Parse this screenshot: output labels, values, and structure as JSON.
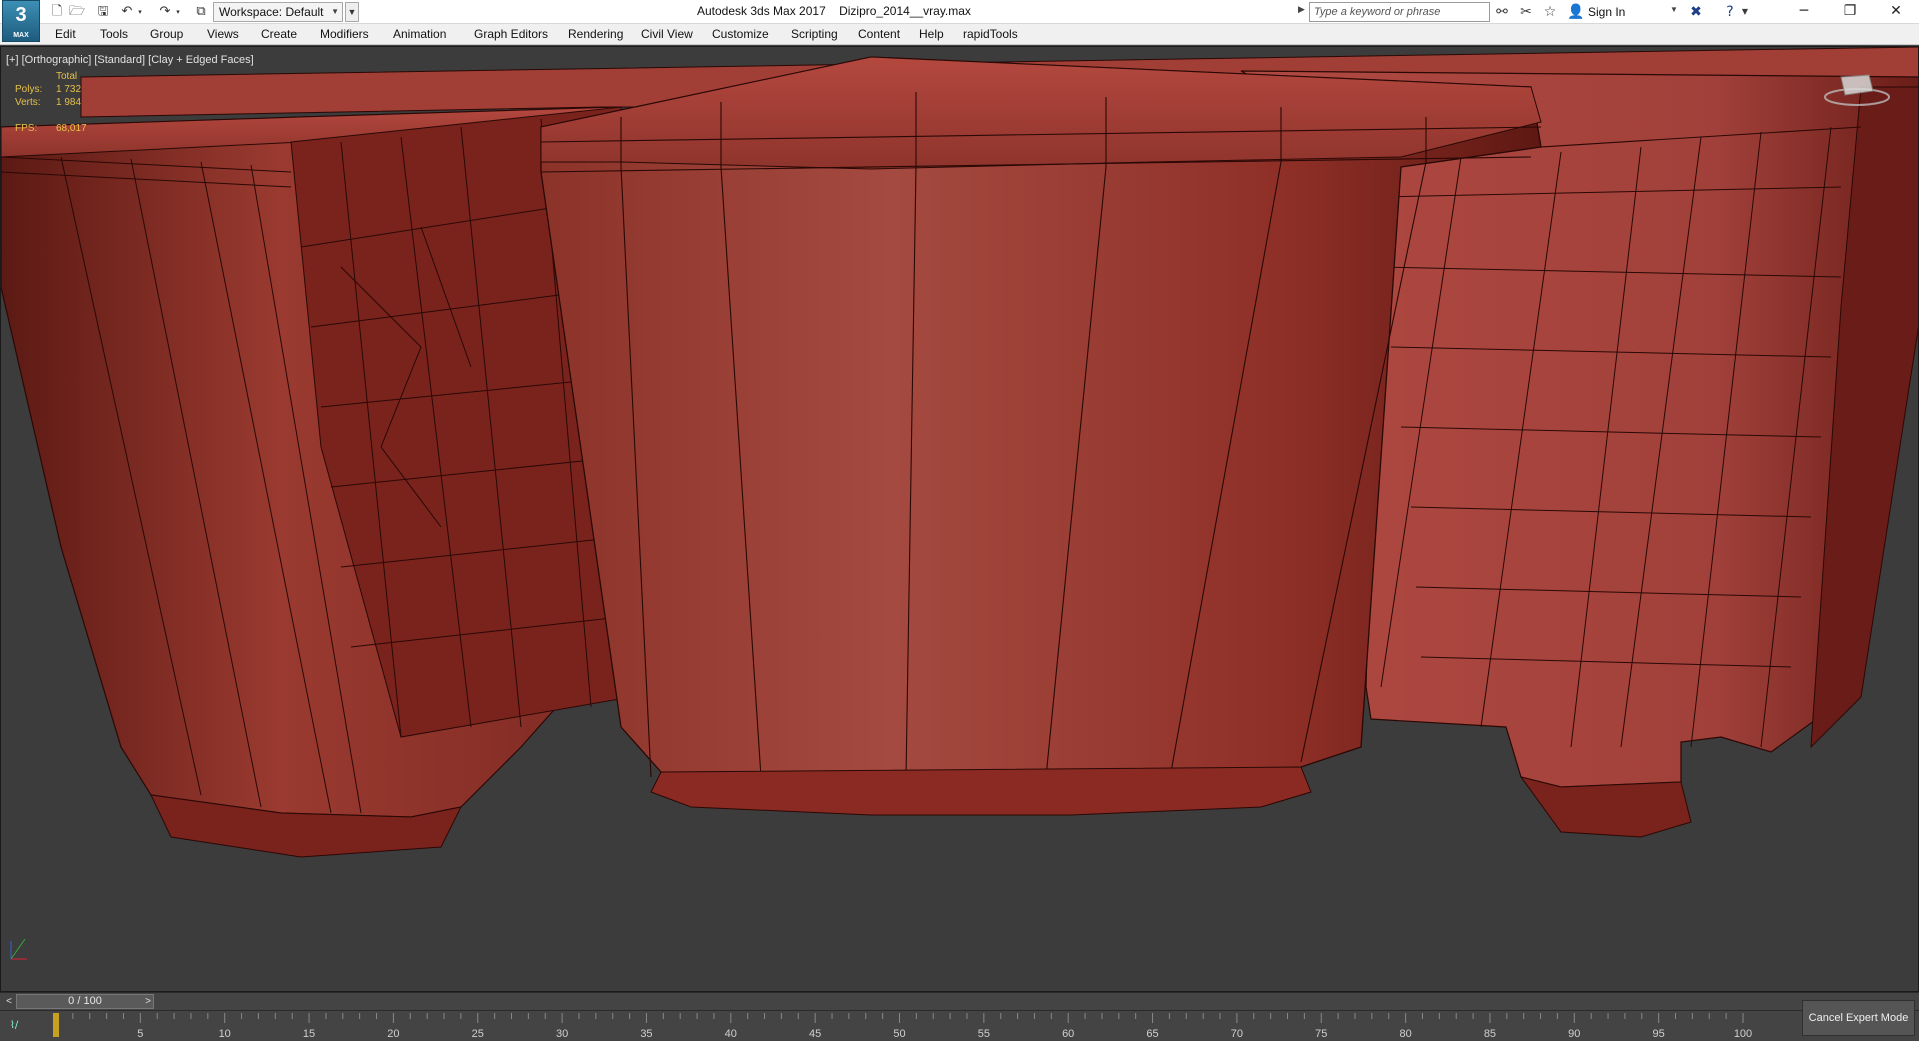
{
  "titlebar": {
    "logo_text": "3",
    "logo_sub": "MAX",
    "workspace_label": "Workspace: Default",
    "window_title": "Autodesk 3ds Max 2017    Dizipro_2014__vray.max",
    "search_placeholder": "Type a keyword or phrase",
    "signin_label": "Sign In",
    "quick_access_icons": [
      "new-file-icon",
      "open-folder-icon",
      "save-icon",
      "undo-icon",
      "redo-icon",
      "project-folder-icon"
    ],
    "tool_icons": [
      "binoculars-icon",
      "tools-icon",
      "star-icon",
      "user-icon",
      "x-exchange-icon",
      "help-icon"
    ],
    "window_buttons": [
      "minimize-icon",
      "restore-icon",
      "close-icon"
    ]
  },
  "menu": {
    "items": [
      "Edit",
      "Tools",
      "Group",
      "Views",
      "Create",
      "Modifiers",
      "Animation",
      "Graph Editors",
      "Rendering",
      "Civil View",
      "Customize",
      "Scripting",
      "Content",
      "Help",
      "rapidTools"
    ]
  },
  "viewport": {
    "label": "[+] [Orthographic] [Standard] [Clay + Edged Faces]",
    "stats": {
      "header": "Total",
      "polys_label": "Polys:",
      "polys_value": "1 732",
      "verts_label": "Verts:",
      "verts_value": "1 984",
      "fps_label": "FPS:",
      "fps_value": "68,017"
    },
    "colors": {
      "clay": "#8a2c26",
      "clay_light": "#a63e36",
      "clay_dark": "#5c1712",
      "edge": "#2a0805",
      "background": "#3c3c3c",
      "stat_text": "#e6c14a"
    }
  },
  "timeslider": {
    "position_label": "0 / 100",
    "prev_icon": "chevron-left-icon",
    "next_icon": "chevron-right-icon"
  },
  "trackbar": {
    "ticks": [
      "0",
      "5",
      "10",
      "15",
      "20",
      "25",
      "30",
      "35",
      "40",
      "45",
      "50",
      "55",
      "60",
      "65",
      "70",
      "75",
      "80",
      "85",
      "90",
      "95",
      "100"
    ]
  },
  "statusbar": {
    "expert_button_label": "Cancel Expert Mode"
  }
}
